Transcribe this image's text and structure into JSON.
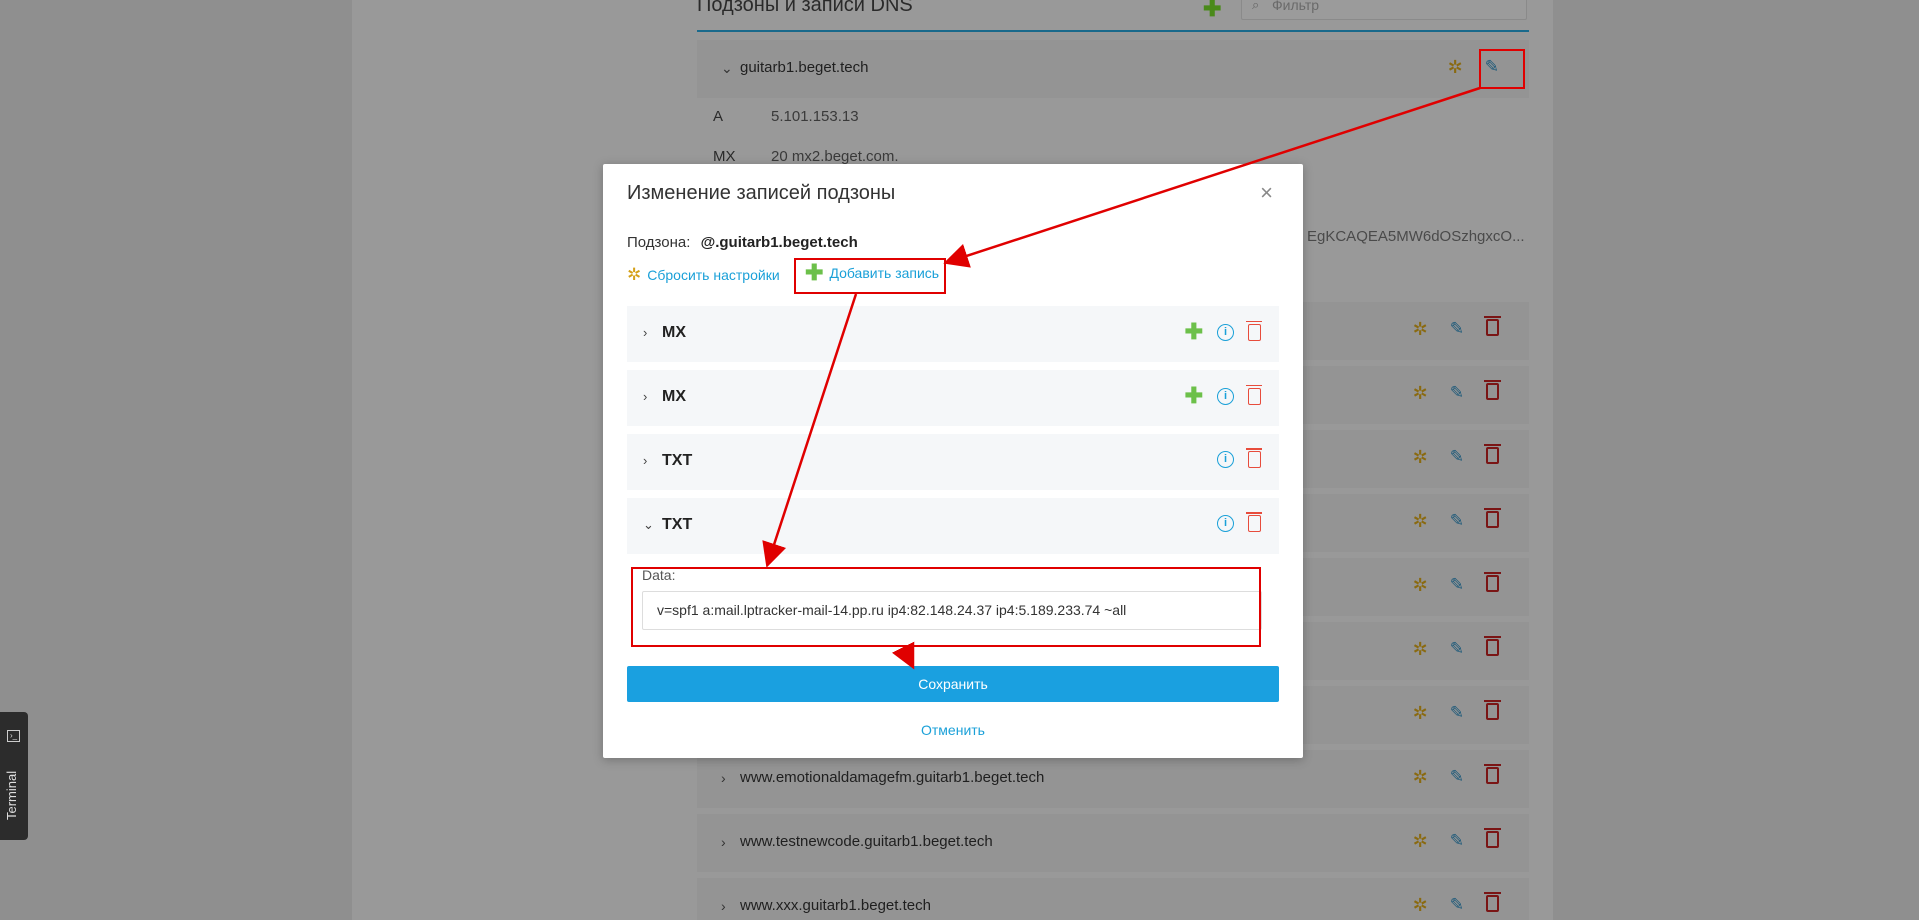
{
  "background": {
    "section_title": "Подзоны и записи DNS",
    "filter_placeholder": "Фильтр",
    "expanded_zone": {
      "name": "guitarb1.beget.tech",
      "records": [
        {
          "type": "A",
          "value": "5.101.153.13"
        },
        {
          "type": "MX",
          "value": "20 mx2.beget.com."
        }
      ],
      "dkim_fragment": "EgKCAQEA5MW6dOSzhgxcO..."
    },
    "zones": [
      "www.emotionaldamagefm.guitarb1.beget.tech",
      "www.testnewcode.guitarb1.beget.tech",
      "www.xxx.guitarb1.beget.tech"
    ]
  },
  "terminal_tab": {
    "label": "Terminal"
  },
  "modal": {
    "title": "Изменение записей подзоны",
    "close_glyph": "×",
    "subzone_label": "Подзона:",
    "subzone_value": "@.guitarb1.beget.tech",
    "reset_link": "Сбросить настройки",
    "add_link": "Добавить запись",
    "records": [
      {
        "type": "MX",
        "chevron": "›",
        "has_add": true
      },
      {
        "type": "MX",
        "chevron": "›",
        "has_add": true
      },
      {
        "type": "TXT",
        "chevron": "›",
        "has_add": false
      },
      {
        "type": "TXT",
        "chevron": "⌄",
        "has_add": false
      }
    ],
    "data_label": "Data:",
    "data_value": "v=spf1 a:mail.lptracker-mail-14.pp.ru ip4:82.148.24.37 ip4:5.189.233.74 ~all",
    "save_button": "Сохранить",
    "cancel_link": "Отменить"
  },
  "colors": {
    "accent": "#1aa0e0",
    "link": "#1aa0d8",
    "add_green": "#6cc04a",
    "delete_red": "#e74c3c",
    "annotation_red": "#e00000"
  }
}
